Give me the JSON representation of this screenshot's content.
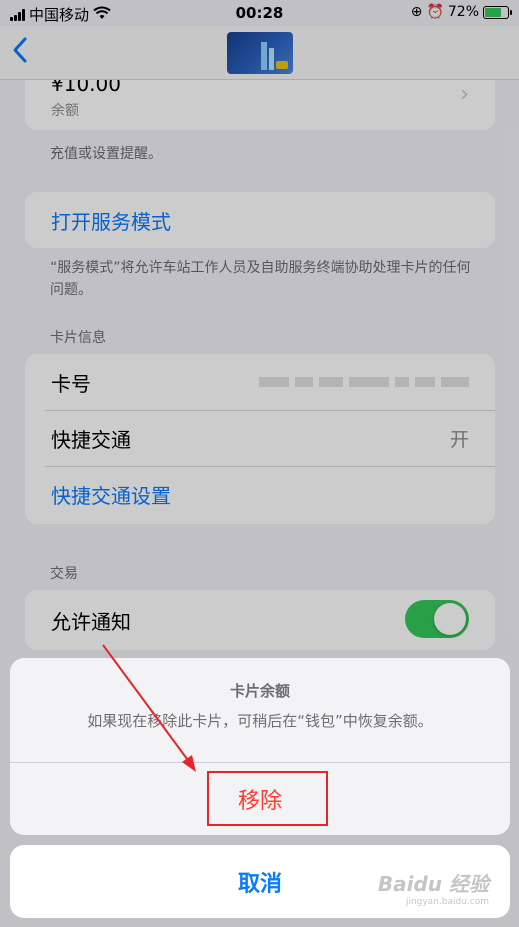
{
  "status_bar": {
    "carrier": "中国移动",
    "time": "00:28",
    "battery": "72%",
    "battery_level": 0.72
  },
  "nav": {
    "back_icon": "chevron-left-icon",
    "card_thumbnail": "transit-card-image"
  },
  "balance": {
    "amount": "¥10.00",
    "label": "余额",
    "footer": "充值或设置提醒。"
  },
  "service_mode": {
    "label": "打开服务模式",
    "footer": "“服务模式”将允许车站工作人员及自助服务终端协助处理卡片的任何问题。"
  },
  "card_info": {
    "header": "卡片信息",
    "card_number_label": "卡号",
    "express_transit_label": "快捷交通",
    "express_transit_value": "开",
    "express_transit_settings": "快捷交通设置"
  },
  "transactions": {
    "header": "交易",
    "allow_notifications_label": "允许通知",
    "allow_notifications_on": true
  },
  "action_sheet": {
    "title": "卡片余额",
    "message": "如果现在移除此卡片，可稍后在“钱包”中恢复余额。",
    "remove": "移除",
    "cancel": "取消"
  },
  "colors": {
    "accent": "#0a7aff",
    "destructive": "#ff3b30",
    "toggle_on": "#34c759",
    "annotation": "#e3262b"
  },
  "watermark": {
    "brand": "Baidu 经验",
    "url": "jingyan.baidu.com"
  }
}
